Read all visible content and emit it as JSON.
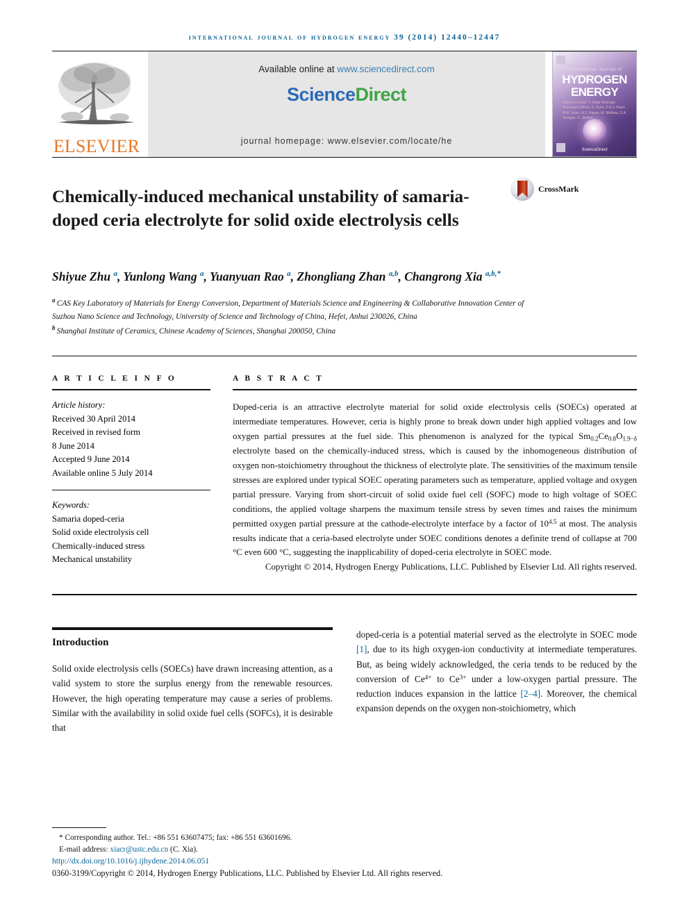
{
  "runninghead": "International Journal of Hydrogen Energy 39 (2014) 12440–12447",
  "masthead": {
    "publisher_logo_label": "ELSEVIER",
    "available_prefix": "Available online at ",
    "available_url": "www.sciencedirect.com",
    "sciencedirect_part1": "Science",
    "sciencedirect_part2": "Direct",
    "journal_homepage": "journal homepage: www.elsevier.com/locate/he",
    "cover": {
      "line_top": "International Journal of",
      "line_1": "HYDROGEN",
      "line_2": "ENERGY",
      "editors": "Editors-in-Chief: T. Nejat Veziroglu   Associate Editors: S. Dunn, D.A.J. Rand, M.R. Islam, M.Z. Hasan, M. Mathew, G.A. Tsongas, D. Stolten",
      "footer_label": "ScienceDirect"
    }
  },
  "article": {
    "title": "Chemically-induced mechanical unstability of samaria-doped ceria electrolyte for solid oxide electrolysis cells",
    "crossmark_label": "CrossMark",
    "authors": [
      {
        "name": "Shiyue Zhu",
        "affil": "a",
        "sep": ", "
      },
      {
        "name": "Yunlong Wang",
        "affil": "a",
        "sep": ", "
      },
      {
        "name": "Yuanyuan Rao",
        "affil": "a",
        "sep": ", "
      },
      {
        "name": "Zhongliang Zhan",
        "affil": "a,b",
        "sep": ", "
      },
      {
        "name": "Changrong Xia",
        "affil": "a,b,*",
        "sep": ""
      }
    ],
    "affiliations": [
      {
        "marker": "a",
        "text": "CAS Key Laboratory of Materials for Energy Conversion, Department of Materials Science and Engineering & Collaborative Innovation Center of Suzhou Nano Science and Technology, University of Science and Technology of China, Hefei, Anhui 230026, China"
      },
      {
        "marker": "b",
        "text": "Shanghai Institute of Ceramics, Chinese Academy of Sciences, Shanghai 200050, China"
      }
    ]
  },
  "article_info": {
    "heading": "A R T I C L E   I N F O",
    "history_label": "Article history:",
    "history": [
      "Received 30 April 2014",
      "Received in revised form",
      "8 June 2014",
      "Accepted 9 June 2014",
      "Available online 5 July 2014"
    ],
    "keywords_label": "Keywords:",
    "keywords": [
      "Samaria doped-ceria",
      "Solid oxide electrolysis cell",
      "Chemically-induced stress",
      "Mechanical unstability"
    ]
  },
  "abstract": {
    "heading": "A B S T R A C T",
    "part1": "Doped-ceria is an attractive electrolyte material for solid oxide electrolysis cells (SOECs) operated at intermediate temperatures. However, ceria is highly prone to break down under high applied voltages and low oxygen partial pressures at the fuel side. This phenomenon is analyzed for the typical ",
    "formula": "Sm0.2Ce0.8O1.9−δ",
    "part2": " electrolyte based on the chemically-induced stress, which is caused by the inhomogeneous distribution of oxygen non-stoichiometry throughout the thickness of electrolyte plate. The sensitivities of the maximum tensile stresses are explored under typical SOEC operating parameters such as temperature, applied voltage and oxygen partial pressure. Varying from short-circuit of solid oxide fuel cell (SOFC) mode to high voltage of SOEC conditions, the applied voltage sharpens the maximum tensile stress by seven times and raises the minimum permitted oxygen partial pressure at the cathode-electrolyte interface by a factor of 10",
    "exponent": "4.5",
    "part3": " at most. The analysis results indicate that a ceria-based electrolyte under SOEC conditions denotes a definite trend of collapse at 700 °C even 600 °C, suggesting the inapplicability of doped-ceria electrolyte in SOEC mode.",
    "copyright": "Copyright © 2014, Hydrogen Energy Publications, LLC. Published by Elsevier Ltd. All rights reserved."
  },
  "body": {
    "section_title": "Introduction",
    "left_paragraph": "Solid oxide electrolysis cells (SOECs) have drawn increasing attention, as a valid system to store the surplus energy from the renewable resources. However, the high operating temperature may cause a series of problems. Similar with the availability in solid oxide fuel cells (SOFCs), it is desirable that",
    "right_segments": [
      {
        "type": "text",
        "value": "doped-ceria is a potential material served as the electrolyte in SOEC mode "
      },
      {
        "type": "ref",
        "value": "[1]"
      },
      {
        "type": "text",
        "value": ", due to its high oxygen-ion conductivity at intermediate temperatures. But, as being widely acknowledged, the ceria tends to be reduced by the conversion of Ce"
      },
      {
        "type": "sup",
        "value": "4+"
      },
      {
        "type": "text",
        "value": " to Ce"
      },
      {
        "type": "sup",
        "value": "3+"
      },
      {
        "type": "text",
        "value": " under a low-oxygen partial pressure. The reduction induces expansion in the lattice "
      },
      {
        "type": "ref",
        "value": "[2–4]"
      },
      {
        "type": "text",
        "value": ". Moreover, the chemical expansion depends on the oxygen non-stoichiometry, which"
      }
    ]
  },
  "footer": {
    "corresponding": "* Corresponding author. Tel.: +86 551 63607475; fax: +86 551 63601696.",
    "email_label": "E-mail address: ",
    "email": "xiacr@ustc.edu.cn",
    "email_suffix": " (C. Xia).",
    "doi": "http://dx.doi.org/10.1016/j.ijhydene.2014.06.051",
    "issn_line": "0360-3199/Copyright © 2014, Hydrogen Energy Publications, LLC. Published by Elsevier Ltd. All rights reserved."
  },
  "colors": {
    "link_blue": "#0b6396",
    "elsevier_orange": "#E87722",
    "sd_blue": "#2c6ab5",
    "sd_green": "#3fa447"
  }
}
